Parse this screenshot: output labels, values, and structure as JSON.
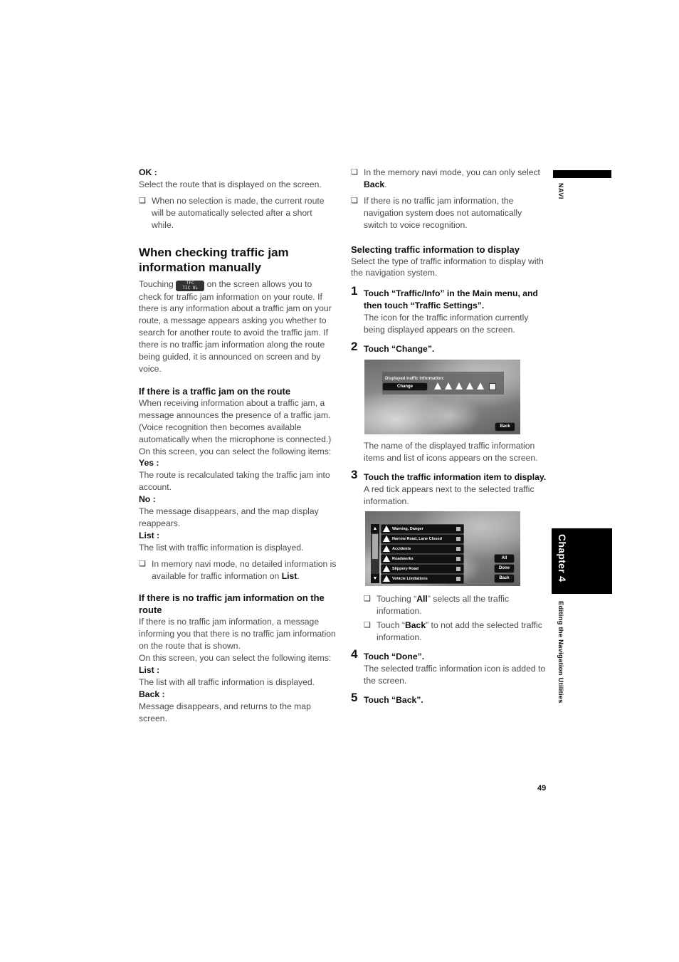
{
  "left": {
    "ok_term": "OK :",
    "ok_desc": "Select the route that is displayed on the screen.",
    "ok_note": "When no selection is made, the current route will be automatically selected after a short while.",
    "heading_manual": "When checking traffic jam information manually",
    "manual_intro_before": "Touching",
    "tmc_button": {
      "line1": "TFC",
      "line2": "TIC UL"
    },
    "manual_intro_after": "on the screen allows you to check for traffic jam information on your route. If there is any information about a traffic jam on your route, a message appears asking you whether to search for another route to avoid the traffic jam. If there is no traffic jam information along the route being guided, it is announced on screen and by voice.",
    "heading_jam": "If there is a traffic jam on the route",
    "jam_desc": "When receiving information about a traffic jam, a message announces the presence of a traffic jam. (Voice recognition then becomes available automatically when the microphone is connected.)",
    "jam_select": "On this screen, you can select the following items:",
    "jam_items": [
      {
        "term": "Yes :",
        "desc": "The route is recalculated taking the traffic jam into account."
      },
      {
        "term": "No :",
        "desc": "The message disappears, and the map display reappears."
      },
      {
        "term": "List :",
        "desc": "The list with traffic information is displayed."
      }
    ],
    "jam_note_before": "In memory navi mode, no detailed information is available for traffic information on",
    "jam_note_bold": "List",
    "jam_note_after": ".",
    "heading_nojam": "If there is no traffic jam information on the route",
    "nojam_desc": "If there is no traffic jam information, a message informing you that there is no traffic jam information on the route that is shown.",
    "nojam_select": "On this screen, you can select the following items:",
    "nojam_items": [
      {
        "term": "List :",
        "desc": "The list with all traffic information is displayed."
      },
      {
        "term": "Back :",
        "desc": "Message disappears, and returns to the map screen."
      }
    ]
  },
  "right": {
    "note1_before": "In the memory navi mode, you can only select",
    "note1_bold": "Back",
    "note1_after": ".",
    "note2": "If there is no traffic jam information, the navigation system does not automatically switch to voice recognition.",
    "heading_select": "Selecting traffic information to display",
    "select_desc": "Select the type of traffic information to display with the navigation system.",
    "steps": [
      {
        "num": "1",
        "title": "Touch “Traffic/Info” in the Main menu, and then touch “Traffic Settings”.",
        "desc": "The icon for the traffic information currently being displayed appears on the screen."
      },
      {
        "num": "2",
        "title": "Touch “Change”.",
        "desc": "The name of the displayed traffic information items and list of icons appears on the screen."
      },
      {
        "num": "3",
        "title": "Touch the traffic information item to display.",
        "desc": "A red tick appears next to the selected traffic information."
      },
      {
        "num": "4",
        "title": "Touch “Done”.",
        "desc": "The selected traffic information icon is added to the screen."
      },
      {
        "num": "5",
        "title": "Touch “Back”.",
        "desc": ""
      }
    ],
    "screen1": {
      "panel_title": "Displayed traffic information:",
      "change_button": "Change",
      "back_button": "Back"
    },
    "screen2": {
      "items": [
        "Warning, Danger",
        "Narrow Road, Lane Closed",
        "Accidents",
        "Roadworks",
        "Slippery Road",
        "Vehicle Limitations"
      ],
      "all_button": "All",
      "done_button": "Done",
      "back_button": "Back"
    },
    "note_all": {
      "before": "Touching “",
      "bold": "All",
      "after": "” selects all the traffic information."
    },
    "note_back": {
      "before": "Touch “",
      "bold": "Back",
      "after": "” to not add the selected traffic information."
    }
  },
  "margin": {
    "navi": "NAVI",
    "chapter": "Chapter 4",
    "section": "Editing the Navigation Utilities"
  },
  "page_number": "49",
  "note_glyph": "❏"
}
